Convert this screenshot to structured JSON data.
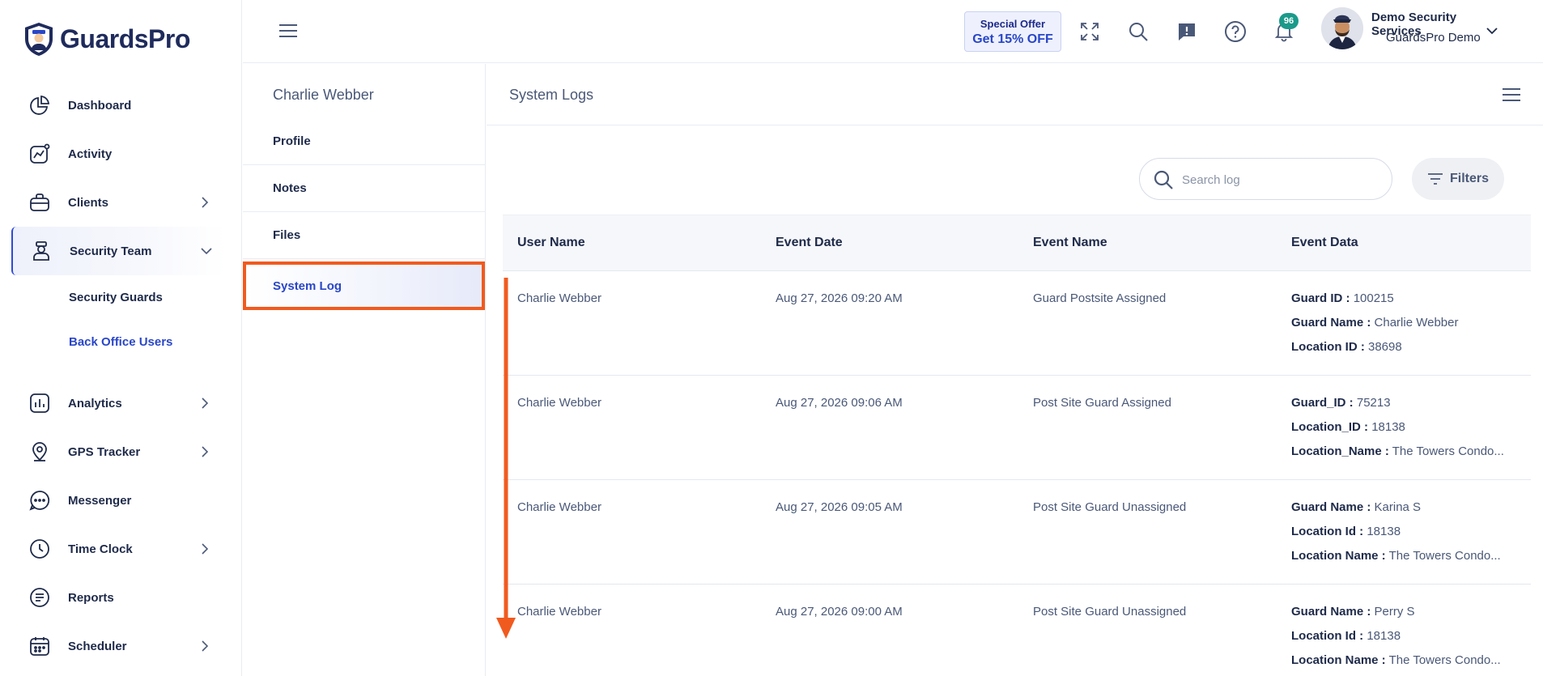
{
  "brand": {
    "name": "GuardsPro"
  },
  "sidebar": {
    "items": [
      {
        "label": "Dashboard",
        "icon": "pie-chart-icon",
        "chevron": false
      },
      {
        "label": "Activity",
        "icon": "activity-chart-icon",
        "chevron": false
      },
      {
        "label": "Clients",
        "icon": "briefcase-icon",
        "chevron": true
      },
      {
        "label": "Security Team",
        "icon": "guard-icon",
        "chevron": true,
        "expanded": true
      },
      {
        "label": "Analytics",
        "icon": "bar-chart-icon",
        "chevron": true
      },
      {
        "label": "GPS Tracker",
        "icon": "location-pin-icon",
        "chevron": true
      },
      {
        "label": "Messenger",
        "icon": "chat-bubble-icon",
        "chevron": false
      },
      {
        "label": "Time Clock",
        "icon": "clock-icon",
        "chevron": true
      },
      {
        "label": "Reports",
        "icon": "report-icon",
        "chevron": false
      },
      {
        "label": "Scheduler",
        "icon": "calendar-icon",
        "chevron": true
      }
    ],
    "security_team_sub": [
      {
        "label": "Security Guards"
      },
      {
        "label": "Back Office Users",
        "selected": true
      }
    ]
  },
  "topbar": {
    "offer_line1": "Special Offer",
    "offer_line2": "Get 15% OFF",
    "notification_count": "96",
    "user_name": "Demo Security Services",
    "company": "GuardsPro Demo"
  },
  "profile_panel": {
    "name": "Charlie Webber",
    "tabs": [
      "Profile",
      "Notes",
      "Files",
      "System Log"
    ],
    "active_tab": "System Log"
  },
  "main": {
    "title": "System Logs",
    "search_placeholder": "Search log",
    "filters_label": "Filters",
    "columns": [
      "User Name",
      "Event Date",
      "Event Name",
      "Event Data"
    ],
    "rows": [
      {
        "user": "Charlie Webber",
        "date": "Aug 27, 2026 09:20 AM",
        "event": "Guard Postsite Assigned",
        "data": [
          {
            "k": "Guard ID :",
            "v": "100215"
          },
          {
            "k": "Guard Name :",
            "v": "Charlie Webber"
          },
          {
            "k": "Location ID :",
            "v": "38698"
          }
        ]
      },
      {
        "user": "Charlie Webber",
        "date": "Aug 27, 2026 09:06 AM",
        "event": "Post Site Guard Assigned",
        "data": [
          {
            "k": "Guard_ID :",
            "v": "75213"
          },
          {
            "k": "Location_ID :",
            "v": "18138"
          },
          {
            "k": "Location_Name :",
            "v": "The Towers Condo..."
          }
        ]
      },
      {
        "user": "Charlie Webber",
        "date": "Aug 27, 2026 09:05 AM",
        "event": "Post Site Guard Unassigned",
        "data": [
          {
            "k": "Guard Name :",
            "v": "Karina S"
          },
          {
            "k": "Location Id :",
            "v": "18138"
          },
          {
            "k": "Location Name :",
            "v": "The Towers Condo..."
          }
        ]
      },
      {
        "user": "Charlie Webber",
        "date": "Aug 27, 2026 09:00 AM",
        "event": "Post Site Guard Unassigned",
        "data": [
          {
            "k": "Guard Name :",
            "v": "Perry S"
          },
          {
            "k": "Location Id :",
            "v": "18138"
          },
          {
            "k": "Location Name :",
            "v": "The Towers Condo..."
          }
        ]
      }
    ]
  },
  "colors": {
    "brand": "#1f2b5c",
    "accent": "#2946c8",
    "highlight": "#f15a1f",
    "badge": "#1a9a8a"
  }
}
